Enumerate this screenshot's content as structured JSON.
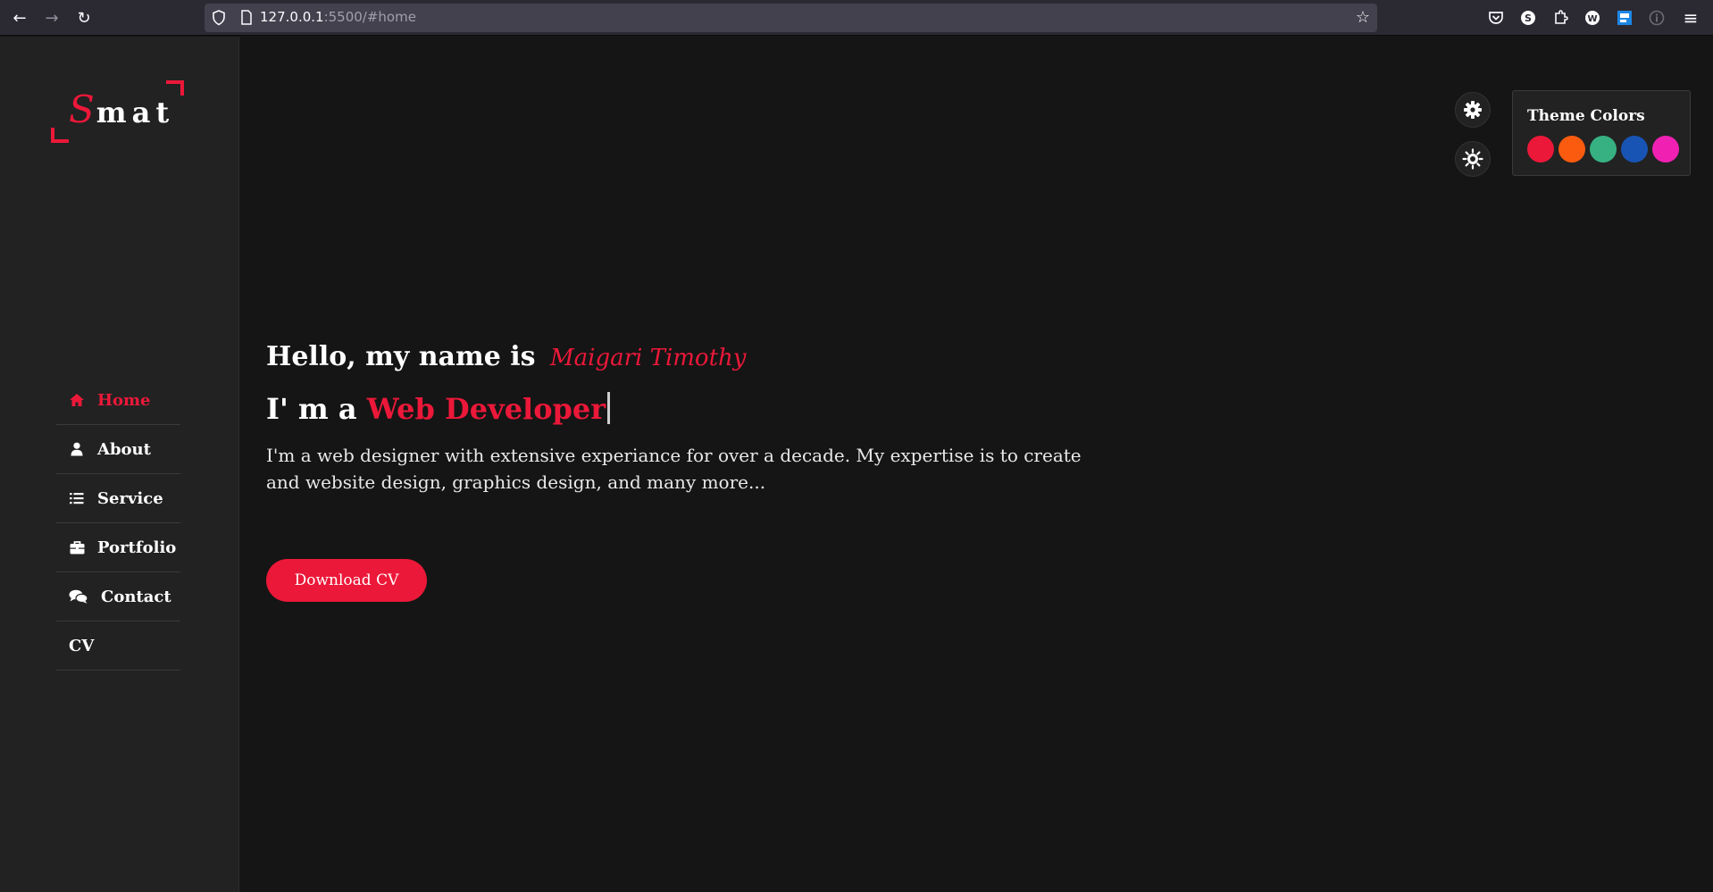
{
  "browser": {
    "url_host": "127.0.0.1",
    "url_rest": ":5500/#home",
    "back_glyph": "←",
    "forward_glyph": "→",
    "reload_glyph": "↻",
    "star_glyph": "☆",
    "menu_glyph": "≡",
    "extensions": [
      "pocket-icon",
      "s-extension-icon",
      "extensions-icon",
      "w-extension-icon",
      "flag-extension-icon",
      "info-extension-icon"
    ]
  },
  "logo": {
    "first_letter": "S",
    "rest": "mat"
  },
  "nav": {
    "items": [
      {
        "label": "Home",
        "icon": "home-icon",
        "active": true
      },
      {
        "label": "About",
        "icon": "user-icon",
        "active": false
      },
      {
        "label": "Service",
        "icon": "list-icon",
        "active": false
      },
      {
        "label": "Portfolio",
        "icon": "briefcase-icon",
        "active": false
      },
      {
        "label": "Contact",
        "icon": "comments-icon",
        "active": false
      },
      {
        "label": "CV",
        "icon": "",
        "active": false
      }
    ]
  },
  "hero": {
    "greeting": "Hello, my name is",
    "name": "Maigari Timothy",
    "iam": "I' m a",
    "role": "Web Developer",
    "description": "I'm a web designer with extensive experiance for over a decade. My expertise is to create and website design, graphics design, and many more...",
    "cv_button": "Download CV"
  },
  "theme": {
    "title": "Theme Colors",
    "accent": "#ec1839",
    "colors": [
      "#ec1839",
      "#fa5b0f",
      "#37b182",
      "#1854b4",
      "#f021b2"
    ]
  }
}
